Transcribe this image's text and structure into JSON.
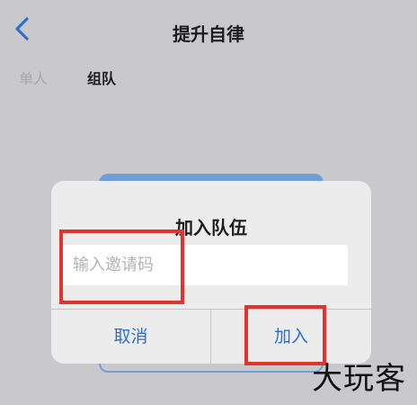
{
  "header": {
    "title": "提升自律"
  },
  "tabs": [
    {
      "label": "单人"
    },
    {
      "label": "组队"
    }
  ],
  "dialog": {
    "title": "加入队伍",
    "input": {
      "placeholder": "输入邀请码",
      "value": ""
    },
    "cancel_label": "取消",
    "join_label": "加入"
  },
  "colors": {
    "accent": "#2a6fd1",
    "highlight": "#e0342f",
    "overlay_background": "#c9c9cb"
  },
  "icons": {
    "back": "chevron-left-icon"
  },
  "watermark": "大玩客"
}
